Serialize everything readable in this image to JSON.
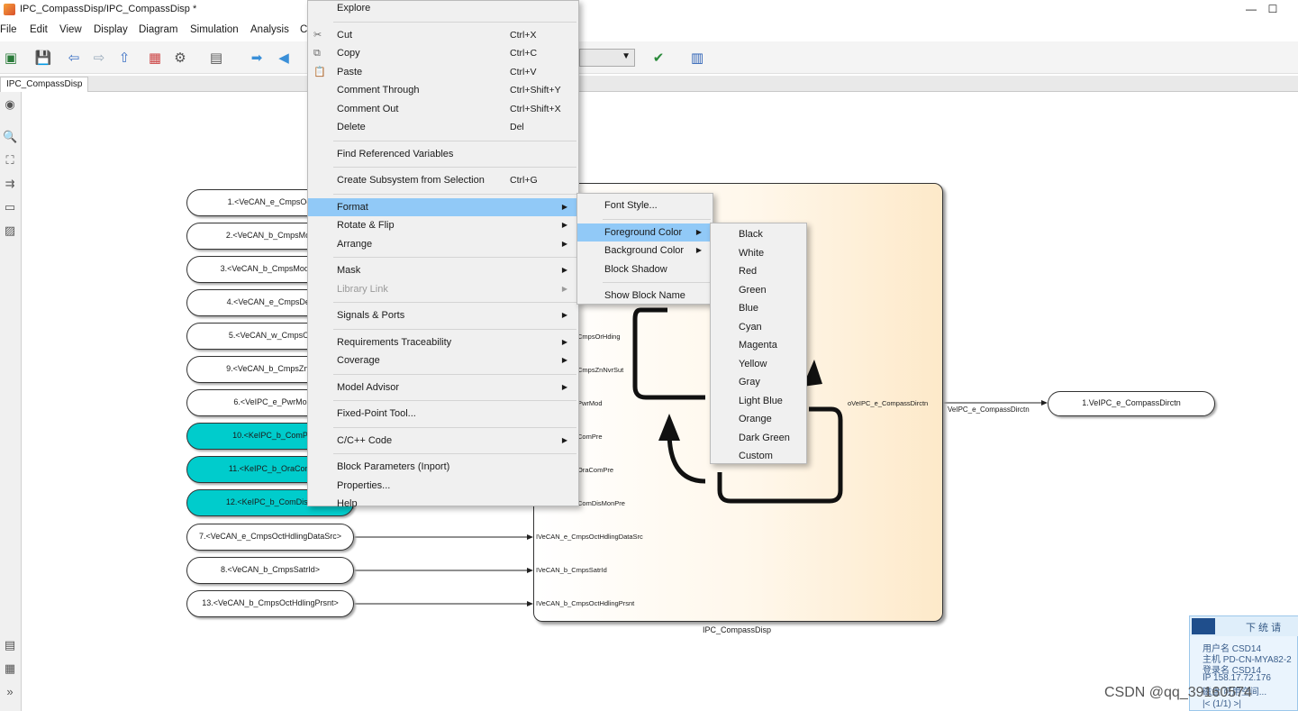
{
  "window": {
    "title": "IPC_CompassDisp/IPC_CompassDisp *",
    "minimize": "—",
    "maximize": "☐"
  },
  "menubar": [
    "File",
    "Edit",
    "View",
    "Display",
    "Diagram",
    "Simulation",
    "Analysis",
    "C"
  ],
  "tab": {
    "label": "IPC_CompassDisp"
  },
  "inports": [
    {
      "label": "1.<VeCAN_e_CmpsOct",
      "highlighted": false
    },
    {
      "label": "2.<VeCAN_b_CmpsMod",
      "highlighted": false
    },
    {
      "label": "3.<VeCAN_b_CmpsModMa",
      "highlighted": false
    },
    {
      "label": "4.<VeCAN_e_CmpsDec",
      "highlighted": false
    },
    {
      "label": "5.<VeCAN_w_CmpsOr",
      "highlighted": false
    },
    {
      "label": "9.<VeCAN_b_CmpsZnN",
      "highlighted": false
    },
    {
      "label": "6.<VeIPC_e_PwrMo",
      "highlighted": false
    },
    {
      "label": "10.<KeIPC_b_ComP",
      "highlighted": true
    },
    {
      "label": "11.<KeIPC_b_OraCom",
      "highlighted": true
    },
    {
      "label": "12.<KeIPC_b_ComDisM",
      "highlighted": true
    },
    {
      "label": "7.<VeCAN_e_CmpsOctHdlingDataSrc>",
      "highlighted": false
    },
    {
      "label": "8.<VeCAN_b_CmpsSatrId>",
      "highlighted": false
    },
    {
      "label": "13.<VeCAN_b_CmpsOctHdlingPrsnt>",
      "highlighted": false
    }
  ],
  "subsystem": {
    "name": "IPC_CompassDisp",
    "inputs": [
      "CmpsOrHding",
      "CmpsZnNvrSut",
      "PwrMod",
      "ComPre",
      "OraComPre",
      "ComDisMonPre",
      "IVeCAN_e_CmpsOctHdlingDataSrc",
      "IVeCAN_b_CmpsSatrId",
      "IVeCAN_b_CmpsOctHdlingPrsnt"
    ],
    "output": "oVeIPC_e_CompassDirctn"
  },
  "signal_label": "VeIPC_e_CompassDirctn",
  "outport": {
    "label": "1.VeIPC_e_CompassDirctn"
  },
  "context_menu": {
    "items": [
      {
        "label": "Explore",
        "shortcut": ""
      },
      {
        "sep": true
      },
      {
        "label": "Cut",
        "shortcut": "Ctrl+X",
        "icon": "✂"
      },
      {
        "label": "Copy",
        "shortcut": "Ctrl+C",
        "icon": "⧉"
      },
      {
        "label": "Paste",
        "shortcut": "Ctrl+V",
        "icon": "📋"
      },
      {
        "label": "Comment Through",
        "shortcut": "Ctrl+Shift+Y"
      },
      {
        "label": "Comment Out",
        "shortcut": "Ctrl+Shift+X"
      },
      {
        "label": "Delete",
        "shortcut": "Del"
      },
      {
        "sep": true
      },
      {
        "label": "Find Referenced Variables",
        "shortcut": ""
      },
      {
        "sep": true
      },
      {
        "label": "Create Subsystem from Selection",
        "shortcut": "Ctrl+G"
      },
      {
        "sep": true
      },
      {
        "label": "Format",
        "submenu": true,
        "highlighted": true
      },
      {
        "label": "Rotate & Flip",
        "submenu": true
      },
      {
        "label": "Arrange",
        "submenu": true
      },
      {
        "sep": true
      },
      {
        "label": "Mask",
        "submenu": true
      },
      {
        "label": "Library Link",
        "submenu": true,
        "disabled": true
      },
      {
        "sep": true
      },
      {
        "label": "Signals & Ports",
        "submenu": true
      },
      {
        "sep": true
      },
      {
        "label": "Requirements Traceability",
        "submenu": true
      },
      {
        "label": "Coverage",
        "submenu": true
      },
      {
        "sep": true
      },
      {
        "label": "Model Advisor",
        "submenu": true
      },
      {
        "sep": true
      },
      {
        "label": "Fixed-Point Tool...",
        "shortcut": ""
      },
      {
        "sep": true
      },
      {
        "label": "C/C++ Code",
        "submenu": true
      },
      {
        "sep": true
      },
      {
        "label": "Block Parameters (Inport)",
        "shortcut": ""
      },
      {
        "label": "Properties...",
        "shortcut": ""
      },
      {
        "label": "Help",
        "shortcut": ""
      }
    ]
  },
  "format_menu": {
    "items": [
      {
        "label": "Font Style...",
        "submenu": false
      },
      {
        "sep": true
      },
      {
        "label": "Foreground Color",
        "submenu": true,
        "highlighted": true
      },
      {
        "label": "Background Color",
        "submenu": true
      },
      {
        "label": "Block Shadow",
        "submenu": false
      },
      {
        "sep": true
      },
      {
        "label": "Show Block Name",
        "submenu": false
      }
    ]
  },
  "color_menu": {
    "items": [
      "Black",
      "White",
      "Red",
      "Green",
      "Blue",
      "Cyan",
      "Magenta",
      "Yellow",
      "Gray",
      "Light Blue",
      "Orange",
      "Dark Green",
      "Custom"
    ]
  },
  "widget": {
    "header": "下 统 请",
    "lines": [
      "用户名 CSD14",
      "主机 PD-CN-MYA82-2",
      "登录名 CSD14",
      "IP 158.17.72.176",
      "磁盘 可用空间...",
      "|< (1/1) >|"
    ]
  },
  "watermark": "CSDN @qq_39160574",
  "colors": {
    "highlight": "#91c9f7",
    "cyan_block": "#00cccc",
    "menu_bg": "#f0f0f0",
    "subsystem_fill": "#fde9c9"
  }
}
